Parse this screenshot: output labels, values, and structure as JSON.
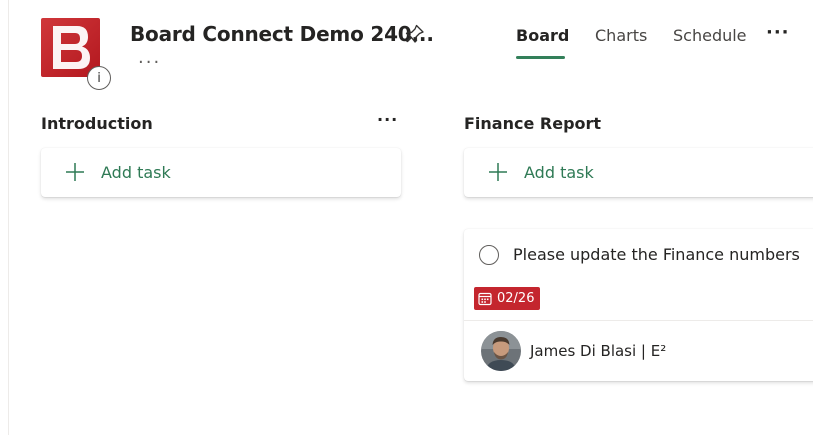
{
  "header": {
    "plan_title": "Board Connect Demo 240...",
    "info_symbol": "i",
    "more_symbol": "...",
    "tabs": [
      {
        "label": "Board",
        "selected": true
      },
      {
        "label": "Charts",
        "selected": false
      },
      {
        "label": "Schedule",
        "selected": false
      }
    ],
    "tabs_more_symbol": "···",
    "icons": {
      "logo": "board-b-logo-icon",
      "pin": "pin-icon"
    }
  },
  "buckets": [
    {
      "name": "Introduction",
      "more_symbol": "···",
      "add_task_label": "Add task"
    },
    {
      "name": "Finance Report",
      "add_task_label": "Add task"
    }
  ],
  "task": {
    "title": "Please update the Finance numbers",
    "due_date": "02/26",
    "assignee": "James Di Blasi | E²",
    "icons": {
      "complete": "circle-checkbox-icon",
      "due": "calendar-icon"
    }
  },
  "colors": {
    "brand_red": "#c4262e",
    "accent_green": "#33805a",
    "add_task_green": "#2f7a55",
    "overdue_red": "#c4262e"
  }
}
